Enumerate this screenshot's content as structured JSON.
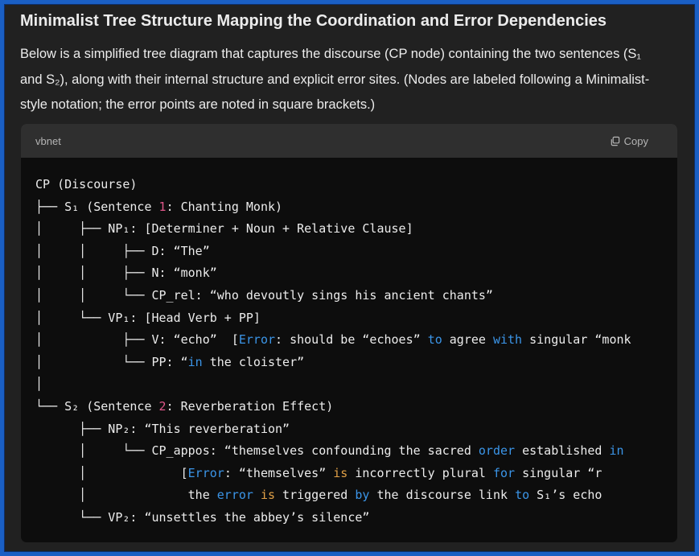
{
  "heading": "Minimalist Tree Structure Mapping the Coordination and Error Dependencies",
  "intro": "Below is a simplified tree diagram that captures the discourse (CP node) containing the two sentences (S₁ and S₂), along with their internal structure and explicit error sites. (Nodes are labeled following a Minimalist-style notation; the error points are noted in square brackets.)",
  "code_block": {
    "language": "vbnet",
    "copy_label": "Copy",
    "lines": [
      [
        {
          "t": "CP (Discourse)"
        }
      ],
      [
        {
          "t": "├── S₁ (Sentence "
        },
        {
          "t": "1",
          "c": "num"
        },
        {
          "t": ": Chanting Monk)"
        }
      ],
      [
        {
          "t": "│     ├── NP₁: [Determiner + Noun + Relative Clause]"
        }
      ],
      [
        {
          "t": "│     │     ├── D: “The”"
        }
      ],
      [
        {
          "t": "│     │     ├── N: “monk”"
        }
      ],
      [
        {
          "t": "│     │     └── CP_rel: “who devoutly sings his ancient chants”"
        }
      ],
      [
        {
          "t": "│     └── VP₁: [Head Verb + PP]"
        }
      ],
      [
        {
          "t": "│           ├── V: “echo”  ["
        },
        {
          "t": "Error",
          "c": "kw"
        },
        {
          "t": ": should be “echoes” "
        },
        {
          "t": "to",
          "c": "kw"
        },
        {
          "t": " agree "
        },
        {
          "t": "with",
          "c": "kw"
        },
        {
          "t": " singular “monk"
        }
      ],
      [
        {
          "t": "│           └── PP: “"
        },
        {
          "t": "in",
          "c": "kw"
        },
        {
          "t": " the cloister”"
        }
      ],
      [
        {
          "t": "│"
        }
      ],
      [
        {
          "t": "└── S₂ (Sentence "
        },
        {
          "t": "2",
          "c": "num"
        },
        {
          "t": ": Reverberation Effect)"
        }
      ],
      [
        {
          "t": "      ├── NP₂: “This reverberation”"
        }
      ],
      [
        {
          "t": "      │     └── CP_appos: “themselves confounding the sacred "
        },
        {
          "t": "order",
          "c": "kw"
        },
        {
          "t": " established "
        },
        {
          "t": "in",
          "c": "kw"
        },
        {
          "t": " "
        }
      ],
      [
        {
          "t": "      │             ["
        },
        {
          "t": "Error",
          "c": "kw"
        },
        {
          "t": ": “themselves” "
        },
        {
          "t": "is",
          "c": "hl"
        },
        {
          "t": " incorrectly plural "
        },
        {
          "t": "for",
          "c": "kw"
        },
        {
          "t": " singular “r"
        }
      ],
      [
        {
          "t": "      │              the "
        },
        {
          "t": "error",
          "c": "kw"
        },
        {
          "t": " "
        },
        {
          "t": "is",
          "c": "hl"
        },
        {
          "t": " triggered "
        },
        {
          "t": "by",
          "c": "kw"
        },
        {
          "t": " the discourse link "
        },
        {
          "t": "to",
          "c": "kw"
        },
        {
          "t": " S₁’s echo"
        }
      ],
      [
        {
          "t": "      └── VP₂: “unsettles the abbey’s silence”"
        }
      ]
    ]
  }
}
